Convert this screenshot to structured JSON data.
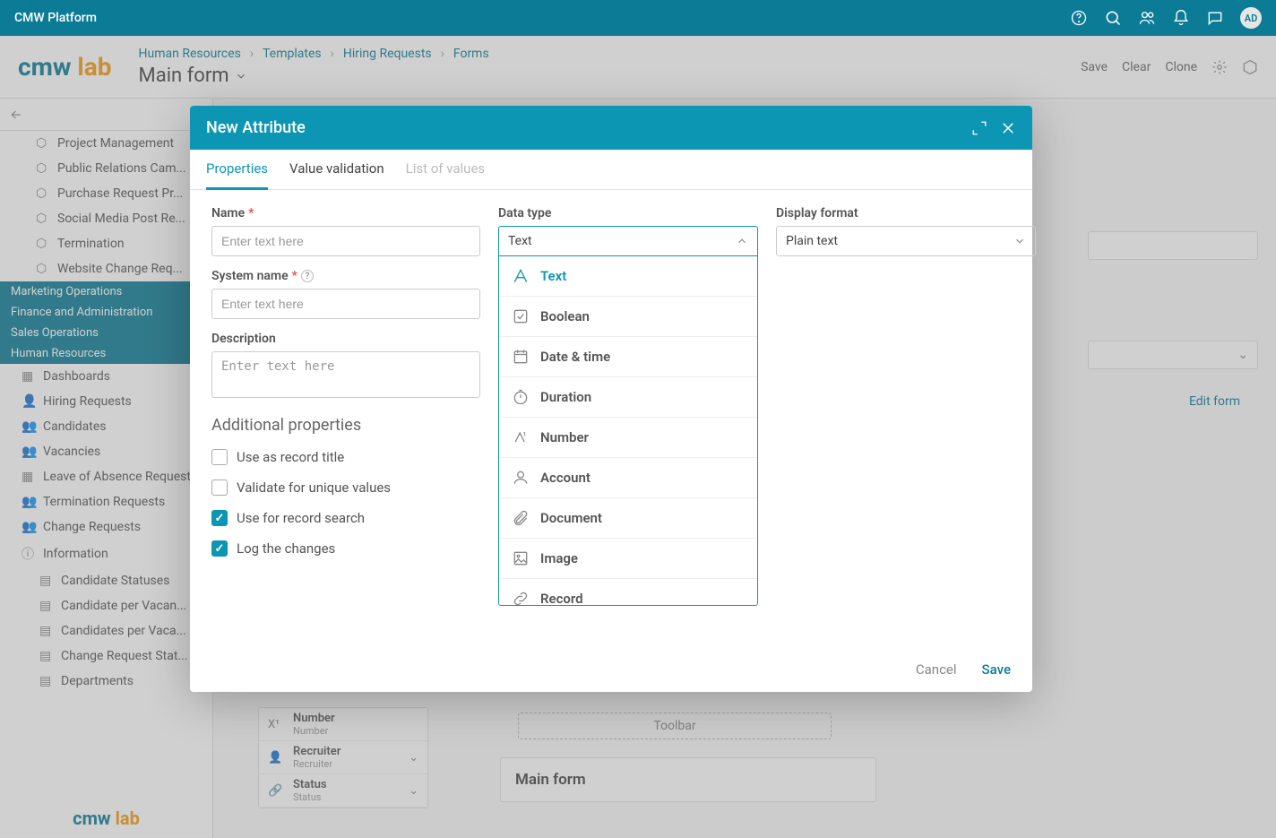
{
  "topbar": {
    "title": "CMW Platform",
    "avatar": "AD"
  },
  "header": {
    "logo_cmw": "cmw",
    "logo_lab": "lab",
    "breadcrumb": [
      "Human Resources",
      "Templates",
      "Hiring Requests",
      "Forms"
    ],
    "page_title": "Main form",
    "actions": {
      "save": "Save",
      "clear": "Clear",
      "clone": "Clone"
    }
  },
  "sidebar": {
    "tree_top": [
      "Project Management",
      "Public Relations Cam...",
      "Purchase Request Pr...",
      "Social Media Post Re...",
      "Termination",
      "Website Change Req..."
    ],
    "groups": [
      "Marketing Operations",
      "Finance and Administration",
      "Sales Operations",
      "Human Resources"
    ],
    "hr_items": [
      "Dashboards",
      "Hiring Requests",
      "Candidates",
      "Vacancies",
      "Leave of Absence Requests",
      "Termination Requests",
      "Change Requests",
      "Information"
    ],
    "info_items": [
      "Candidate Statuses",
      "Candidate per Vacan...",
      "Candidates per Vaca...",
      "Change Request Stat...",
      "Departments"
    ]
  },
  "modal": {
    "title": "New Attribute",
    "tabs": {
      "properties": "Properties",
      "validation": "Value validation",
      "list": "List of values"
    },
    "labels": {
      "name": "Name",
      "sysname": "System name",
      "desc": "Description",
      "datatype": "Data type",
      "display": "Display format",
      "additional": "Additional properties"
    },
    "placeholders": {
      "name": "Enter text here",
      "sysname": "Enter text here",
      "desc": "Enter text here"
    },
    "datatype_value": "Text",
    "display_value": "Plain text",
    "datatype_options": [
      "Text",
      "Boolean",
      "Date & time",
      "Duration",
      "Number",
      "Account",
      "Document",
      "Image",
      "Record"
    ],
    "checkboxes": {
      "record_title": "Use as record title",
      "unique": "Validate for unique values",
      "search": "Use for record search",
      "log": "Log the changes"
    },
    "footer": {
      "cancel": "Cancel",
      "save": "Save"
    }
  },
  "background": {
    "edit_form": "Edit form",
    "toolbar": "Toolbar",
    "main_form": "Main form",
    "attrs": [
      {
        "label": "Number",
        "sub": "Number"
      },
      {
        "label": "Recruiter",
        "sub": "Recruiter"
      },
      {
        "label": "Status",
        "sub": "Status"
      }
    ]
  }
}
